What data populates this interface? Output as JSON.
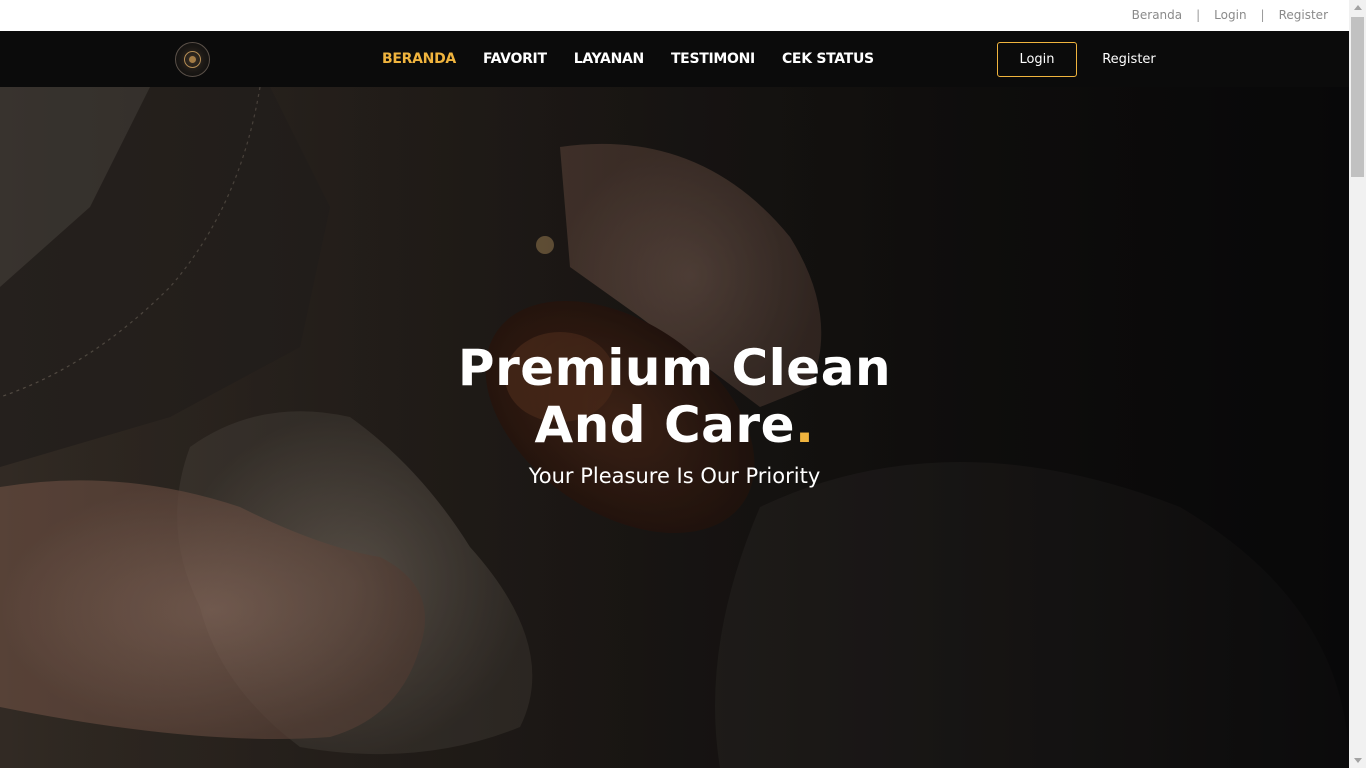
{
  "topbar": {
    "links": [
      "Beranda",
      "Login",
      "Register"
    ],
    "separator": "|"
  },
  "navbar": {
    "logo_icon": "brand-logo-icon",
    "items": [
      {
        "label": "BERANDA",
        "active": true
      },
      {
        "label": "FAVORIT",
        "active": false
      },
      {
        "label": "LAYANAN",
        "active": false
      },
      {
        "label": "TESTIMONI",
        "active": false
      },
      {
        "label": "CEK STATUS",
        "active": false
      }
    ],
    "login_label": "Login",
    "register_label": "Register"
  },
  "hero": {
    "title_line1": "Premium Clean",
    "title_line2": "And Care",
    "title_dot": ".",
    "subtitle": "Your Pleasure Is Our Priority"
  },
  "colors": {
    "accent": "#f0b43e",
    "navbar_bg": "#0b0b0b",
    "text_light": "#ffffff"
  }
}
